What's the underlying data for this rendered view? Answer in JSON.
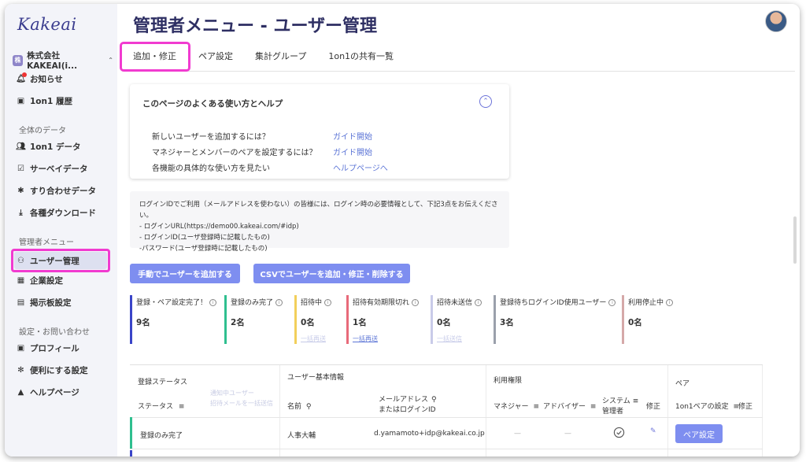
{
  "app": {
    "logo": "Kakeai"
  },
  "sidebar": {
    "company_badge": "株",
    "company": "株式会社KAKEAI(i...",
    "top_items": [
      {
        "label": "お知らせ"
      },
      {
        "label": "1on1 履歴"
      }
    ],
    "section_data": "全体のデータ",
    "data_items": [
      {
        "label": "1on1 データ"
      },
      {
        "label": "サーベイデータ"
      },
      {
        "label": "すり合わせデータ"
      },
      {
        "label": "各種ダウンロード"
      }
    ],
    "section_admin": "管理者メニュー",
    "admin_items": [
      {
        "label": "ユーザー管理"
      },
      {
        "label": "企業設定"
      },
      {
        "label": "掲示板設定"
      }
    ],
    "section_settings": "設定・お問い合わせ",
    "settings_items": [
      {
        "label": "プロフィール"
      },
      {
        "label": "便利にする設定"
      },
      {
        "label": "ヘルプページ"
      }
    ]
  },
  "header": {
    "title": "管理者メニュー - ユーザー管理"
  },
  "tabs": [
    {
      "label": "追加・修正"
    },
    {
      "label": "ペア設定"
    },
    {
      "label": "集計グループ"
    },
    {
      "label": "1on1の共有一覧"
    }
  ],
  "help": {
    "title": "このページのよくある使い方とヘルプ",
    "rows": [
      {
        "q": "新しいユーザーを追加するには？",
        "link": "ガイド開始"
      },
      {
        "q": "マネジャーとメンバーのペアを設定するには？",
        "link": "ガイド開始"
      },
      {
        "q": "各機能の具体的な使い方を見たい",
        "link": "ヘルプページへ"
      }
    ]
  },
  "info": {
    "lines": [
      "ログインIDでご利用（メールアドレスを使わない）の皆様には、ログイン時の必要情報として、下記3点をお伝えください。",
      "- ログインURL(https://demo00.kakeai.com/#idp)",
      "- ログインID(ユーザ登録時に記載したもの)",
      "-パスワード(ユーザ登録時に記載したもの)"
    ]
  },
  "buttons": {
    "add_manual": "手動でユーザーを追加する",
    "csv": "CSVでユーザーを追加・修正・削除する"
  },
  "stats": [
    {
      "label": "登録・ペア設定完了！",
      "value": "9名",
      "sub": "",
      "color": "#3a45c8"
    },
    {
      "label": "登録のみ完了",
      "value": "2名",
      "sub": "",
      "color": "#2fbf8f"
    },
    {
      "label": "招待中",
      "value": "0名",
      "sub": "一括再送",
      "color": "#f2cf5b"
    },
    {
      "label": "招待有効期限切れ",
      "value": "1名",
      "sub": "一括再送",
      "color": "#e86a7a"
    },
    {
      "label": "招待未送信",
      "value": "0名",
      "sub": "一括送信",
      "color": "#c9cbe9"
    },
    {
      "label": "登録待ちログインID使用ユーザー",
      "value": "3名",
      "sub": "",
      "color": "#9aa0ab"
    },
    {
      "label": "利用停止中",
      "value": "0名",
      "sub": "",
      "color": "#d5a9a9"
    }
  ],
  "table": {
    "group_status": "登録ステータス",
    "group_basic": "ユーザー基本情報",
    "group_perm": "利用権限",
    "group_pair": "ペア",
    "col_status": "ステータス",
    "status_links": [
      "通知中ユーザー",
      "招待メールを一括送信"
    ],
    "col_name": "名前",
    "col_email_1": "メールアドレス",
    "col_email_2": "またはログインID",
    "col_manager": "マネジャー",
    "col_advisor": "アドバイザー",
    "col_sysadmin_1": "システム",
    "col_sysadmin_2": "管理者",
    "col_edit": "修正",
    "col_pair": "1on1ペアの設定",
    "col_pair_edit": "修正",
    "rows": [
      {
        "status": "登録のみ完了",
        "name": "人事大輔",
        "email": "d.yamamoto+idp@kakeai.co.jp",
        "manager": "—",
        "advisor": "—",
        "pair_button": "ペア設定"
      }
    ]
  }
}
